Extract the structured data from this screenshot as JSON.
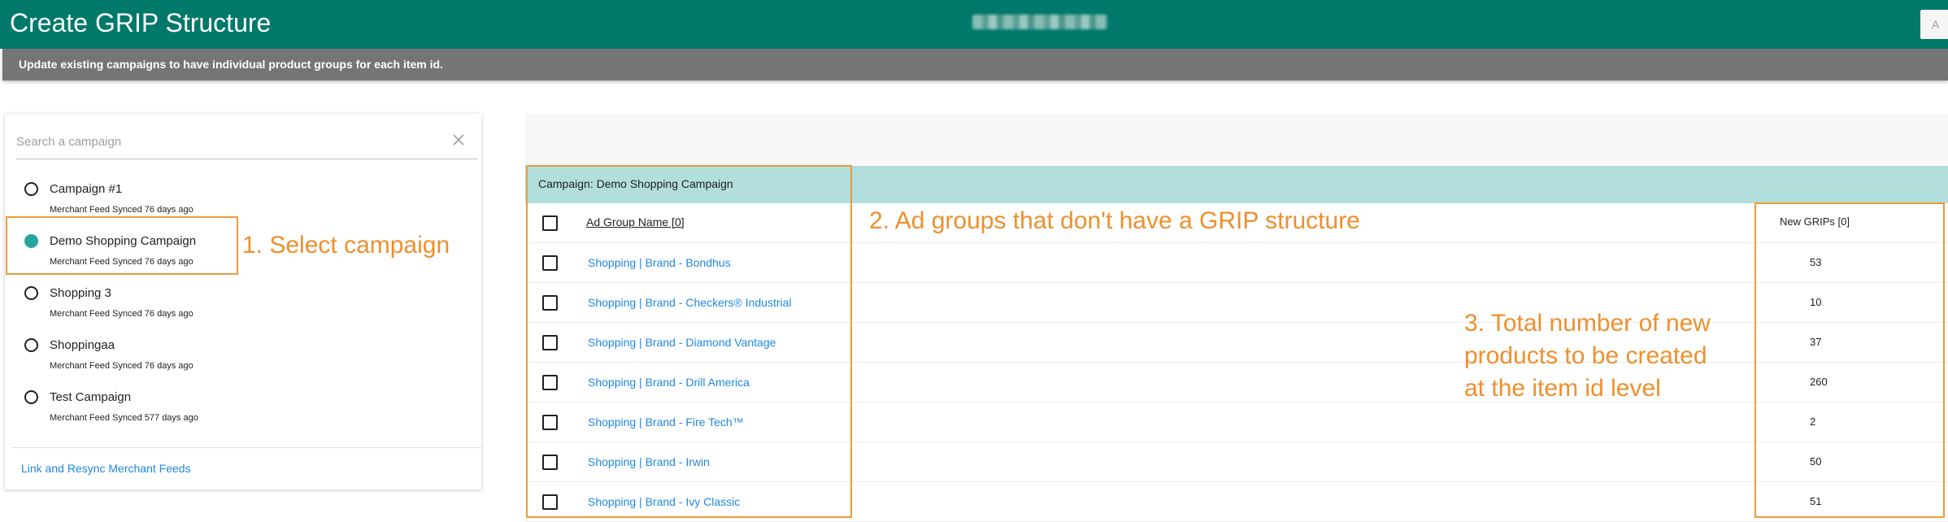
{
  "header": {
    "title": "Create GRIP Structure",
    "subtitle": "Update existing campaigns to have individual product groups for each item id."
  },
  "search": {
    "placeholder": "Search a campaign",
    "value": ""
  },
  "campaigns": [
    {
      "name": "Campaign #1",
      "sync": "Merchant Feed Synced 76 days ago",
      "selected": false
    },
    {
      "name": "Demo Shopping Campaign",
      "sync": "Merchant Feed Synced 76 days ago",
      "selected": true
    },
    {
      "name": "Shopping 3",
      "sync": "Merchant Feed Synced 76 days ago",
      "selected": false
    },
    {
      "name": "Shoppingaa",
      "sync": "Merchant Feed Synced 76 days ago",
      "selected": false
    },
    {
      "name": "Test Campaign",
      "sync": "Merchant Feed Synced 577 days ago",
      "selected": false
    }
  ],
  "resync_link": "Link and Resync Merchant Feeds",
  "selected_campaign_label": "Campaign: Demo Shopping Campaign",
  "table": {
    "header_name": "Ad Group Name [0]",
    "header_grips": "New GRIPs [0]",
    "rows": [
      {
        "name": "Shopping | Brand - Bondhus",
        "grips": "53"
      },
      {
        "name": "Shopping | Brand - Checkers® Industrial",
        "grips": "10"
      },
      {
        "name": "Shopping | Brand - Diamond Vantage",
        "grips": "37"
      },
      {
        "name": "Shopping | Brand - Drill America",
        "grips": "260"
      },
      {
        "name": "Shopping | Brand - Fire Tech™",
        "grips": "2"
      },
      {
        "name": "Shopping | Brand - Irwin",
        "grips": "50"
      },
      {
        "name": "Shopping | Brand - Ivy Classic",
        "grips": "51"
      }
    ]
  },
  "annotations": {
    "step1": "1. Select campaign",
    "step2": "2. Ad groups that don't have a GRIP structure",
    "step3": [
      "3. Total number of new",
      "products to be created",
      "at the item id level"
    ],
    "color": "#ef8f2c"
  },
  "colors": {
    "header": "#00796b",
    "subheader": "#757575",
    "campaign_bar": "#b2dfdb",
    "link": "#1e88e5",
    "radio_selected": "#26a69a"
  }
}
